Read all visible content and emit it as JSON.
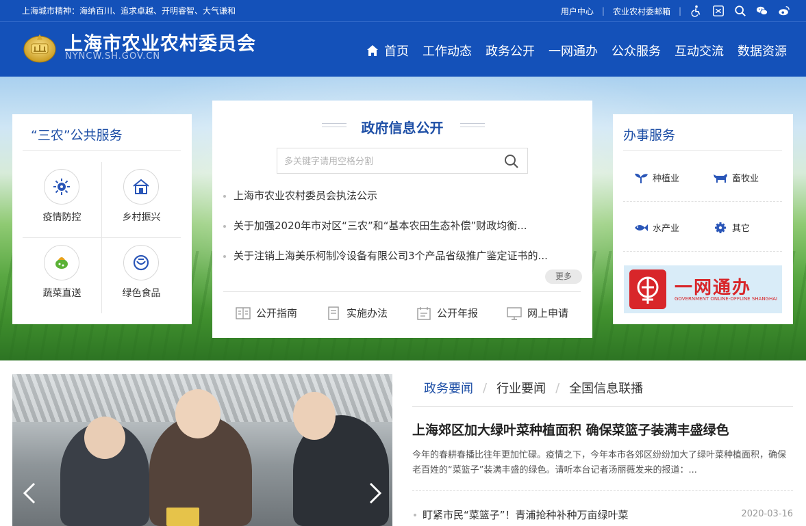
{
  "topbar": {
    "spirit": "上海城市精神：海纳百川、追求卓越、开明睿智、大气谦和",
    "user_center": "用户中心",
    "mailbox": "农业农村委邮箱",
    "icons": [
      "accessibility-icon",
      "elder-mode-icon",
      "search-icon",
      "wechat-icon",
      "weibo-icon"
    ]
  },
  "header": {
    "title": "上海市农业农村委员会",
    "domain": "NYNCW.SH.GOV.CN"
  },
  "nav": {
    "items": [
      "首页",
      "工作动态",
      "政务公开",
      "一网通办",
      "公众服务",
      "互动交流",
      "数据资源"
    ]
  },
  "left_panel": {
    "title": "“三农”公共服务",
    "services": [
      {
        "label": "疫情防控",
        "icon": "virus-icon"
      },
      {
        "label": "乡村振兴",
        "icon": "house-icon"
      },
      {
        "label": "蔬菜直送",
        "icon": "vegetable-icon"
      },
      {
        "label": "绿色食品",
        "icon": "green-food-icon"
      }
    ]
  },
  "center_panel": {
    "title": "政府信息公开",
    "search_placeholder": "多关键字请用空格分割",
    "news": [
      "上海市农业农村委员会执法公示",
      "关于加强2020年市对区“三农”和“基本农田生态补偿”财政均衡...",
      "关于注销上海美乐柯制冷设备有限公司3个产品省级推广鉴定证书的..."
    ],
    "more": "更多",
    "quick_links": [
      "公开指南",
      "实施办法",
      "公开年报",
      "网上申请"
    ]
  },
  "right_panel": {
    "title": "办事服务",
    "items": [
      {
        "label": "种植业",
        "icon": "sprout-icon"
      },
      {
        "label": "畜牧业",
        "icon": "cattle-icon"
      },
      {
        "label": "水产业",
        "icon": "fish-icon"
      },
      {
        "label": "其它",
        "icon": "gear-icon"
      }
    ],
    "banner_cn": "一网通办",
    "banner_en": "GOVERNMENT ONLINE-OFFLINE SHANGHAI"
  },
  "news_section": {
    "tabs": [
      "政务要闻",
      "行业要闻",
      "全国信息联播"
    ],
    "headline": "上海郊区加大绿叶菜种植面积 确保菜篮子装满丰盛绿色",
    "summary": "今年的春耕春播比往年更加忙碌。疫情之下，今年本市各郊区纷纷加大了绿叶菜种植面积，确保老百姓的“菜篮子”装满丰盛的绿色。请听本台记者汤丽薇发来的报道：...",
    "items": [
      {
        "title": "盯紧市民“菜篮子”！青浦抢种补种万亩绿叶菜",
        "date": "2020-03-16"
      }
    ]
  },
  "colors": {
    "brand_blue": "#1451b9",
    "accent_blue": "#1e4fa6",
    "banner_red": "#d8262a"
  }
}
